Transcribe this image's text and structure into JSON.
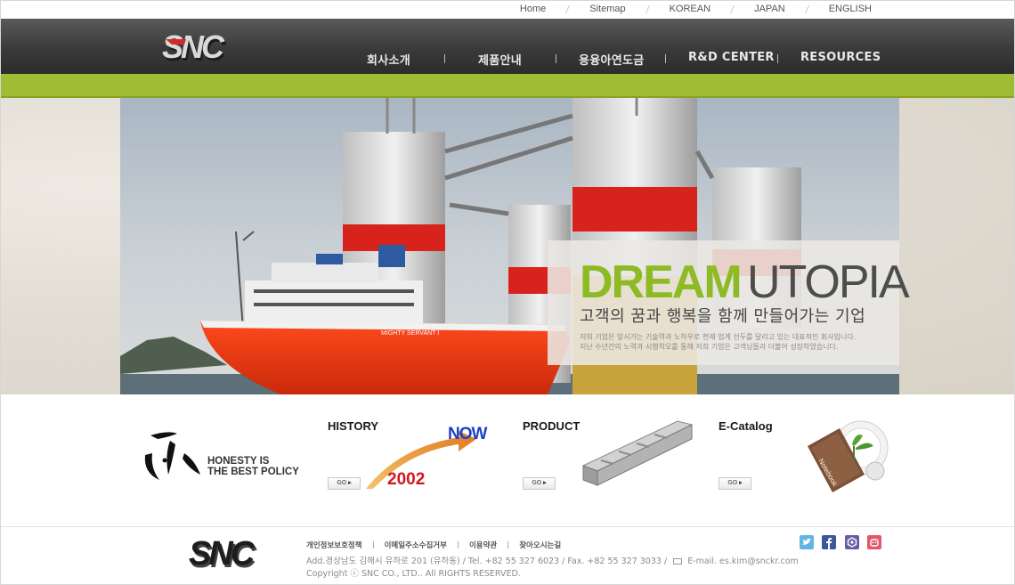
{
  "util_nav": {
    "items": [
      "Home",
      "Sitemap",
      "KOREAN",
      "JAPAN",
      "ENGLISH"
    ]
  },
  "brand": {
    "logo_text": "SNC"
  },
  "main_nav": {
    "items": [
      "회사소개",
      "제품안내",
      "용융아연도금",
      "R&D CENTER",
      "RESOURCES"
    ]
  },
  "hero": {
    "ship_name": "MIGHTY SERVANT I",
    "headline_1": "DREAM",
    "headline_2": "UTOPIA",
    "subline": "고객의 꿈과 행복을 함께 만들어가는 기업",
    "desc_1": "저희 기업은 앞서가는 기술력과 노하우로 현재 업계 선두를 달리고 있는 대표적인 회사입니다.",
    "desc_2": "지난 수년간의 노력과 시행착오를 통해 저희 기업은 고객님들과 더불어 성장하였습니다."
  },
  "policy": {
    "line_1": "HONESTY IS",
    "line_2": "THE BEST POLICY"
  },
  "sections": [
    {
      "title": "HISTORY",
      "go": "GO",
      "year": "2002",
      "now": "NOW"
    },
    {
      "title": "PRODUCT",
      "go": "GO"
    },
    {
      "title": "E-Catalog",
      "go": "GO",
      "book_label": "Notebook"
    }
  ],
  "footer": {
    "links": [
      "개인정보보호정책",
      "이메일주소수집거부",
      "이용약관",
      "찾아오시는길"
    ],
    "address": "Add.경상남도 김해시 유하로 201 (유하동)  /  Tel. +82 55 327 6023  /  Fax. +82 55 327 3033  /",
    "email": "E-mail. es.kim@snckr.com",
    "copyright": "Copyright ⓒ SNC CO., LTD.. All RIGHTS RESERVED."
  },
  "social": [
    {
      "name": "twitter-icon",
      "color": "#5fb6e6"
    },
    {
      "name": "facebook-icon",
      "color": "#3b5998"
    },
    {
      "name": "blog-icon",
      "color": "#6c5aa8"
    },
    {
      "name": "cafe-icon",
      "color": "#e2576b"
    }
  ],
  "colors": {
    "accent_green": "#9fbd34",
    "header_dark": "#3a3a3a"
  }
}
